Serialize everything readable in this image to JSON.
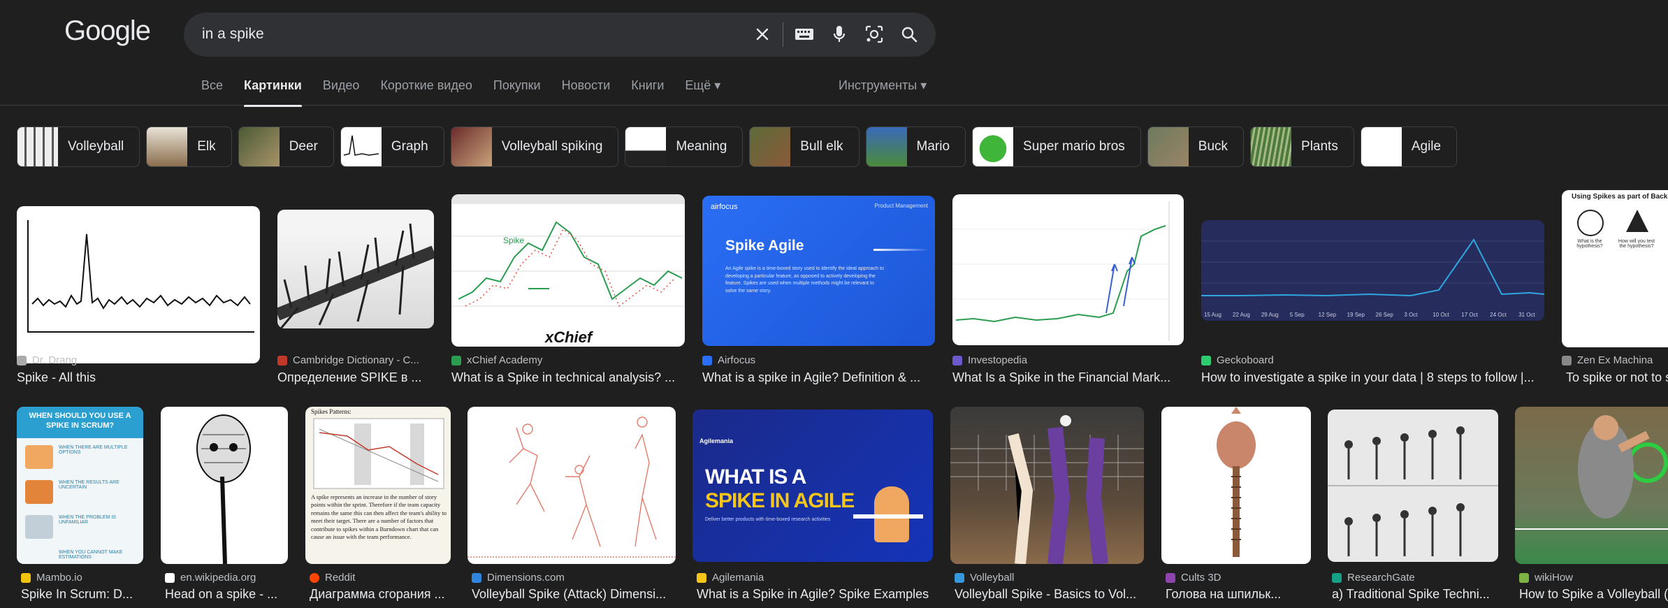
{
  "header": {
    "logo": "Google",
    "search_value": "in a spike"
  },
  "tabs": [
    "Все",
    "Картинки",
    "Видео",
    "Короткие видео",
    "Покупки",
    "Новости",
    "Книги",
    "Ещё ▾"
  ],
  "tools_label": "Инструменты ▾",
  "chips": [
    "Volleyball",
    "Elk",
    "Deer",
    "Graph",
    "Volleyball spiking",
    "Meaning",
    "Bull elk",
    "Mario",
    "Super mario bros",
    "Buck",
    "Plants",
    "Agile"
  ],
  "results_row1": [
    {
      "source": "Dr. Drang",
      "title": "Spike - All this"
    },
    {
      "source": "Cambridge Dictionary - C...",
      "title": "Определение SPIKE в ..."
    },
    {
      "source": "xChief Academy",
      "title": "What is a Spike in technical analysis? ..."
    },
    {
      "source": "Airfocus",
      "title": "What is a spike in Agile? Definition & ..."
    },
    {
      "source": "Investopedia",
      "title": "What Is a Spike in the Financial Mark..."
    },
    {
      "source": "Geckoboard",
      "title": "How to investigate a spike in your data | 8 steps to follow |..."
    },
    {
      "source": "Zen Ex Machina",
      "title": "To spike or not to s"
    }
  ],
  "results_row2": [
    {
      "source": "Mambo.io",
      "title": "Spike In Scrum: D..."
    },
    {
      "source": "en.wikipedia.org",
      "title": "Head on a spike - ..."
    },
    {
      "source": "Reddit",
      "title": "Диаграмма сгорания ..."
    },
    {
      "source": "Dimensions.com",
      "title": "Volleyball Spike (Attack) Dimensi..."
    },
    {
      "source": "Agilemania",
      "title": "What is a Spike in Agile? Spike Examples"
    },
    {
      "source": "Volleyball",
      "title": "Volleyball Spike - Basics to Vol..."
    },
    {
      "source": "Cults 3D",
      "title": "Голова на шпильк..."
    },
    {
      "source": "ResearchGate",
      "title": "a) Traditional Spike Techni..."
    },
    {
      "source": "wikiHow",
      "title": "How to Spike a Volleyball ("
    }
  ],
  "image_text": {
    "xchief_label": "Spike",
    "xchief_logo": "xChief",
    "airfocus_brand": "airfocus",
    "airfocus_nav": "Product Management",
    "airfocus_heading": "Spike Agile",
    "airfocus_body": "An Agile spike is a time-boxed story used to identify the ideal approach to developing a particular feature, as opposed to actively developing the feature. Spikes are used when multiple methods might be relevant to solve the same story.",
    "zen_heading": "Using Spikes as part of Back",
    "zen_q1": "What is the hypothesis?",
    "zen_q2": "How will you test the hypothesis?",
    "mambo_heading": "WHEN SHOULD YOU USE A SPIKE IN SCRUM?",
    "mambo_items": [
      "WHEN THERE ARE MULTIPLE OPTIONS",
      "WHEN THE RESULTS ARE UNCERTAIN",
      "WHEN THE PROBLEM IS UNFAMILIAR",
      "WHEN YOU CANNOT MAKE ESTIMATIONS"
    ],
    "reddit_heading": "Spikes Patterns:",
    "reddit_body": "A spike represents an increase in the number of story points within the sprint. Therefore if the team capacity remains the same this can then affect the team's ability to meet their target. There are a number of factors that contribute to spikes within a Burndown chart that can cause an issue with the team performance.",
    "agilemania_brand": "Agilemania",
    "agilemania_line1": "WHAT IS A",
    "agilemania_line2": "SPIKE IN AGILE",
    "agilemania_sub": "Deliver better products with time-boxed research activities",
    "gecko_dates": [
      "15 Aug",
      "22 Aug",
      "29 Aug",
      "5 Sep",
      "12 Sep",
      "19 Sep",
      "26 Sep",
      "3 Oct",
      "10 Oct",
      "17 Oct",
      "24 Oct",
      "31 Oct"
    ]
  },
  "colors": {
    "background": "#1f1f1f",
    "search_bg": "#303134",
    "text": "#e8eaed",
    "muted": "#9aa0a6",
    "airfocus_blue": "#2a6ef5",
    "agilemania_yellow": "#f5c518",
    "gecko_bg": "#262d5c",
    "gecko_line": "#2fa6e0"
  }
}
